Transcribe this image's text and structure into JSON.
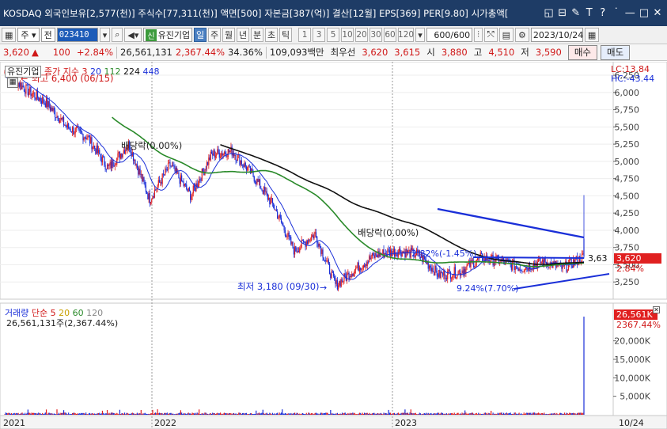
{
  "window": {
    "title": "KOSDAQ 외국인보유[2,577(천)] 주식수[77,311(천)] 액면[500] 자본금[387(억)] 결산[12월] EPS[369] PER[9.80] 시가총액[",
    "icons": [
      "restore-icon",
      "minimize-icon",
      "pin-icon",
      "text-icon",
      "help-icon",
      "more-icon",
      "window-minimize-icon",
      "maximize-icon",
      "close-icon"
    ],
    "icon_glyphs": [
      "◱",
      "⊟",
      "✎",
      "T",
      "?",
      "˙",
      "—",
      "□",
      "✕"
    ]
  },
  "toolbar": {
    "type_select": "주",
    "type2": "전",
    "stock_code": "023410",
    "badge": "신",
    "stock_name": "유진기업",
    "periods": [
      "일",
      "주",
      "월",
      "년",
      "분",
      "초",
      "틱"
    ],
    "active_period": "일",
    "intervals": [
      "1",
      "3",
      "5",
      "10",
      "20",
      "30",
      "60",
      "120"
    ],
    "count_value": "600",
    "count_total": "/600",
    "date_value": "2023/10/24"
  },
  "pricebar": {
    "price": "3,620",
    "change_arrow": "▲",
    "change": "100",
    "change_pct": "+2.84%",
    "volume": "26,561,131",
    "volume_ratio": "2,367.44%",
    "turnover": "34.36%",
    "amount": "109,093백만",
    "best_ask_label": "최우선",
    "best_ask": "3,620",
    "best_bid": "3,615",
    "open_label": "시",
    "open": "3,880",
    "high_label": "고",
    "high": "4,510",
    "low_label": "저",
    "low": "3,590",
    "buy_label": "매수",
    "sell_label": "매도"
  },
  "price_panel": {
    "stock_label": "유진기업",
    "legend_title": "종가 지수 3",
    "legend_mas": [
      "20",
      "112",
      "224",
      "448"
    ],
    "legend_colors": [
      "#1a2fd8",
      "#2a8a2a",
      "#101010",
      "#1a2fd8"
    ],
    "max_label": "최고 6,400 (06/15)",
    "min_label": "최저 3,180 (09/30)",
    "lc_label": "LC:13.84",
    "hc_label": "HC:-43.44",
    "annotation_div1": "배당락(0.00%)",
    "annotation_div2": "배당락(0.00%)",
    "annotation_pct1": "2.82%(-1.45%)",
    "annotation_pct2": "9.24%(7.70%)",
    "line_value": "3,63",
    "current_price_tag": "3,620",
    "current_pct_tag": "2.84%"
  },
  "volume_panel": {
    "legend_title": "거래량",
    "legend_type": "단순",
    "legend_mas": [
      "5",
      "20",
      "60",
      "120"
    ],
    "legend_colors": [
      "#d82020",
      "#c8a000",
      "#2a8a2a",
      "#888888"
    ],
    "stat_label": "26,561,131주(2,367.44%)",
    "volume_tag": "26,561K",
    "volume_pct_tag": "2367.44%"
  },
  "x_axis": {
    "labels": [
      "2021",
      "2022",
      "2023"
    ],
    "last_label": "10/24"
  },
  "chart_data": [
    {
      "type": "candlestick",
      "title": "유진기업",
      "x_range": [
        "2021-06",
        "2023-10-24"
      ],
      "ylim": [
        3000,
        6400
      ],
      "y_ticks": [
        6250,
        6000,
        5750,
        5500,
        5250,
        5000,
        4750,
        4500,
        4250,
        4000,
        3750,
        3500,
        3250
      ],
      "y_tick_labels": [
        "6,250",
        "6,000",
        "5,750",
        "5,500",
        "5,250",
        "5,000",
        "4,750",
        "4,500",
        "4,250",
        "4,000",
        "3,750",
        "3,500",
        "3,250"
      ],
      "close_series": [
        {
          "x": "2021-06",
          "y": 6300
        },
        {
          "x": "2021-07",
          "y": 6050
        },
        {
          "x": "2021-08",
          "y": 5850
        },
        {
          "x": "2021-09",
          "y": 5500
        },
        {
          "x": "2021-10",
          "y": 5350
        },
        {
          "x": "2021-11",
          "y": 4900
        },
        {
          "x": "2021-12",
          "y": 5250
        },
        {
          "x": "2022-01",
          "y": 4450
        },
        {
          "x": "2022-02",
          "y": 4950
        },
        {
          "x": "2022-03",
          "y": 4500
        },
        {
          "x": "2022-04",
          "y": 5100
        },
        {
          "x": "2022-05",
          "y": 5150
        },
        {
          "x": "2022-06",
          "y": 4800
        },
        {
          "x": "2022-07",
          "y": 4350
        },
        {
          "x": "2022-08",
          "y": 3700
        },
        {
          "x": "2022-09",
          "y": 3950
        },
        {
          "x": "2022-10",
          "y": 3200
        },
        {
          "x": "2022-11",
          "y": 3450
        },
        {
          "x": "2022-12",
          "y": 3650
        },
        {
          "x": "2023-01",
          "y": 3700
        },
        {
          "x": "2023-02",
          "y": 3650
        },
        {
          "x": "2023-03",
          "y": 3350
        },
        {
          "x": "2023-04",
          "y": 3400
        },
        {
          "x": "2023-05",
          "y": 3600
        },
        {
          "x": "2023-06",
          "y": 3550
        },
        {
          "x": "2023-07",
          "y": 3450
        },
        {
          "x": "2023-08",
          "y": 3550
        },
        {
          "x": "2023-09",
          "y": 3450
        },
        {
          "x": "2023-10",
          "y": 3620
        }
      ],
      "last_day": {
        "open": 3880,
        "high": 4510,
        "low": 3590,
        "close": 3620
      }
    },
    {
      "type": "bar",
      "title": "거래량",
      "ylim": [
        0,
        26561131
      ],
      "y_ticks": [
        5000000,
        10000000,
        15000000,
        20000000
      ],
      "y_tick_labels": [
        "5,000K",
        "10,000K",
        "15,000K",
        "20,000K"
      ],
      "last_value": 26561131
    }
  ]
}
